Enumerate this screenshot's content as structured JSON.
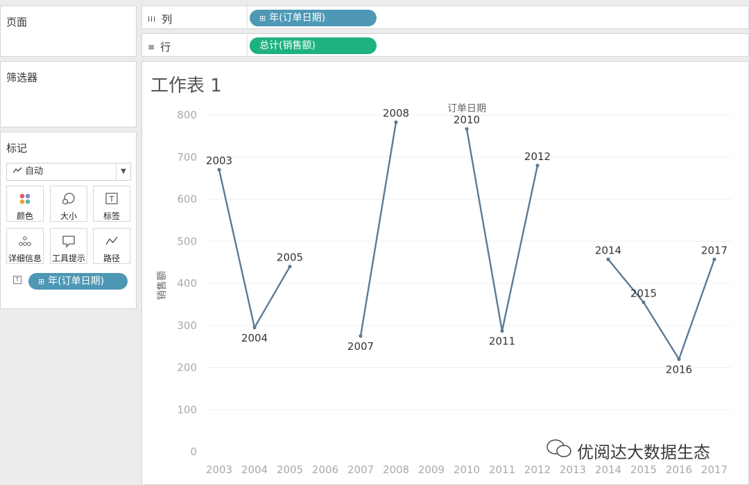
{
  "pages_card": {
    "title": "页面"
  },
  "filters_card": {
    "title": "筛选器"
  },
  "marks_card": {
    "title": "标记",
    "mark_type": "自动",
    "buttons": [
      {
        "label": "颜色",
        "icon": "color-dots-icon"
      },
      {
        "label": "大小",
        "icon": "size-icon"
      },
      {
        "label": "标签",
        "icon": "label-icon"
      },
      {
        "label": "详细信息",
        "icon": "detail-icon"
      },
      {
        "label": "工具提示",
        "icon": "tooltip-icon"
      },
      {
        "label": "路径",
        "icon": "path-icon"
      }
    ],
    "label_field": "年(订单日期)"
  },
  "columns_shelf": {
    "label": "列",
    "pill": "年(订单日期)",
    "pill_color": "#4e98b5"
  },
  "rows_shelf": {
    "label": "行",
    "pill": "总计(销售额)",
    "pill_color": "#1db27f"
  },
  "sheet": {
    "title": "工作表 1"
  },
  "watermark": {
    "text": "优阅达大数据生态"
  },
  "chart_data": {
    "type": "line",
    "title": "",
    "xlabel": "订单日期",
    "ylabel": "销售额",
    "categories": [
      "2003",
      "2004",
      "2005",
      "2006",
      "2007",
      "2008",
      "2009",
      "2010",
      "2011",
      "2012",
      "2013",
      "2014",
      "2015",
      "2016",
      "2017"
    ],
    "series": [
      {
        "values": [
          670,
          295,
          440,
          null,
          275,
          783,
          null,
          767,
          287,
          680,
          null,
          457,
          355,
          220,
          457
        ]
      }
    ],
    "ylim": [
      0,
      800
    ],
    "yticks": [
      0,
      100,
      200,
      300,
      400,
      500,
      600,
      700,
      800
    ],
    "line_color": "#5b7a95",
    "data_labels": "on",
    "grid": "horizontal"
  }
}
